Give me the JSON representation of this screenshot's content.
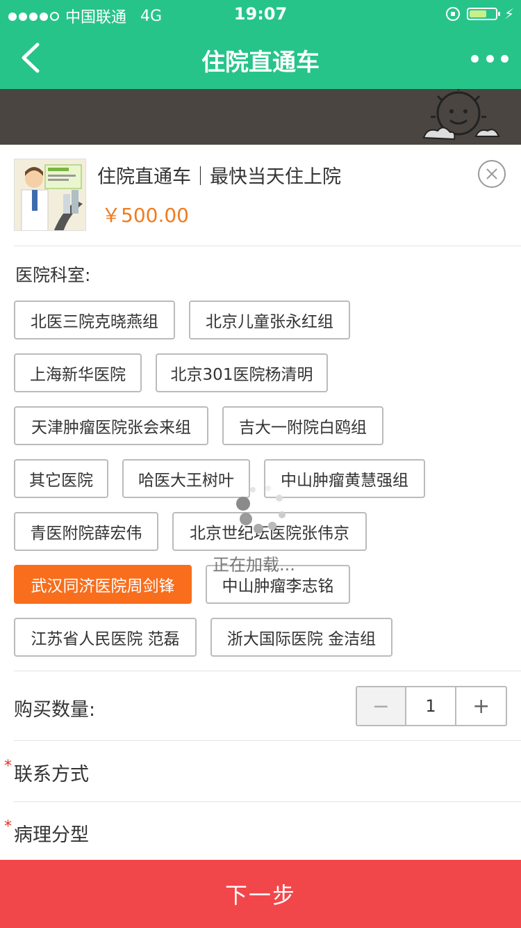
{
  "status_bar": {
    "carrier": "中国联通",
    "network": "4G",
    "time": "19:07"
  },
  "nav": {
    "title": "住院直通车"
  },
  "product": {
    "name": "住院直通车｜最快当天住上院",
    "price": "￥500.00"
  },
  "department": {
    "label": "医院科室:",
    "options": [
      "北医三院克晓燕组",
      "北京儿童张永红组",
      "上海新华医院",
      "北京301医院杨清明",
      "天津肿瘤医院张会来组",
      "吉大一附院白鸥组",
      "其它医院",
      "哈医大王树叶",
      "中山肿瘤黄慧强组",
      "青医附院薛宏伟",
      "北京世纪坛医院张伟京",
      "武汉同济医院周剑锋",
      "中山肿瘤李志铭",
      "江苏省人民医院 范磊",
      "浙大国际医院 金洁组"
    ],
    "selected": "武汉同济医院周剑锋"
  },
  "quantity": {
    "label": "购买数量:",
    "value": "1",
    "minus": "−",
    "plus": "+"
  },
  "fields": {
    "contact": "联系方式",
    "pathology": "病理分型",
    "required_mark": "*"
  },
  "loading": {
    "text": "正在加载..."
  },
  "footer": {
    "next_label": "下一步"
  },
  "colors": {
    "brand_green": "#27c48a",
    "accent_orange": "#f86e1c",
    "price_orange": "#f07c1e",
    "next_red": "#f2474a"
  }
}
